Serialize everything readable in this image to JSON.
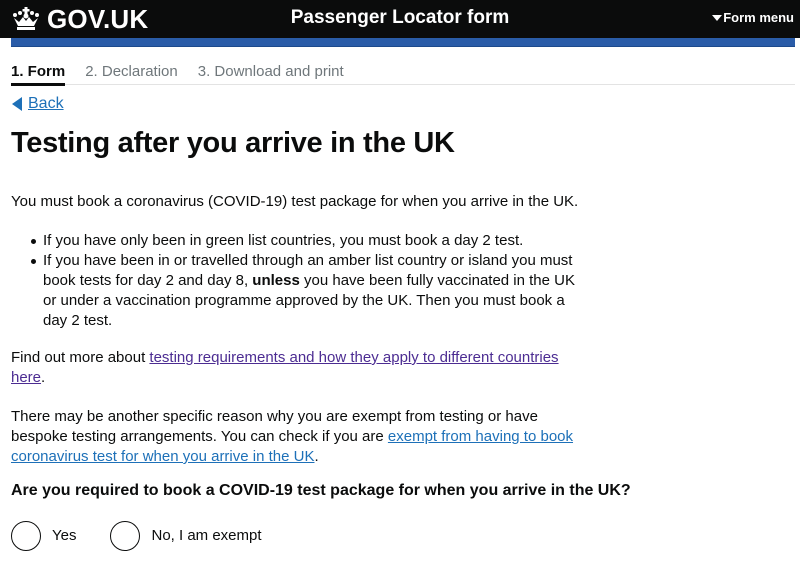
{
  "header": {
    "logo_text": "GOV.UK",
    "logo_icon": "crown-icon",
    "service_name": "Passenger Locator form",
    "form_menu_label": "Form menu",
    "form_menu_icon": "triangle-down-icon",
    "bar_color": "#2a5ca8"
  },
  "steps": [
    {
      "label": "1. Form",
      "active": true
    },
    {
      "label": "2. Declaration",
      "active": false
    },
    {
      "label": "3. Download and print",
      "active": false
    }
  ],
  "back": {
    "label": "Back",
    "icon": "triangle-left-icon"
  },
  "page_title": "Testing after you arrive in the UK",
  "intro": "You must book a coronavirus (COVID-19) test package for when you arrive in the UK.",
  "bullets": {
    "item1": "If you have only been in green list countries, you must book a day 2 test.",
    "item2_part1": "If you have been in or travelled through an amber list country or island you must book tests for day 2 and day 8, ",
    "item2_bold": "unless",
    "item2_part2": " you have been fully vaccinated in the UK or under a vaccination programme approved by the UK. Then you must book a day 2 test."
  },
  "find_out": {
    "prefix": "Find out more about ",
    "link": "testing requirements and how they apply to different countries here",
    "suffix": "."
  },
  "exempt_para": {
    "prefix": "There may be another specific reason why you are exempt from testing or have bespoke testing arrangements. You can check if you are ",
    "link": "exempt from having to book coronavirus test for when you arrive in the UK",
    "suffix": "."
  },
  "question": {
    "label": "Are you required to book a COVID-19 test package for when you arrive in the UK?",
    "options": [
      {
        "label": "Yes",
        "selected": false
      },
      {
        "label": "No, I am exempt",
        "selected": false
      }
    ]
  },
  "colors": {
    "link_visited": "#4c2c92",
    "link": "#1d70b8",
    "text": "#0b0c0c",
    "header_bg": "#0b0c0c"
  }
}
